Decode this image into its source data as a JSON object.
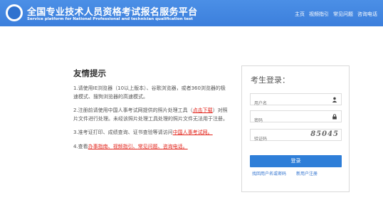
{
  "header": {
    "title_cn": "全国专业技术人员资格考试报名服务平台",
    "title_en": "Service platform for National Professional and technician qualification test",
    "nav": [
      "主页",
      "视频指引",
      "常见问题",
      "咨询电话"
    ]
  },
  "notice": {
    "heading": "友情提示",
    "item1": "1.请使用IE浏览器（10以上版本）、谷歌浏览器，或者360浏览器的极速模式、搜狗浏览器的高速模式。",
    "item2_a": "2.注册前请使用中国人事考试网提供的照片处理工具（",
    "item2_link": "点击下载",
    "item2_b": "）对照片文件进行处理。未经该照片处理工具处理的照片文件无法用于注册。",
    "item3_a": "3.准考证打印、成绩查询、证书查验等请访问",
    "item3_link": "中国人事考试网。",
    "item4_a": "4.查看",
    "item4_links": [
      "办事指南、",
      "视频指引、",
      "常见问题、",
      "咨询电话。"
    ]
  },
  "login": {
    "title": "考生登录：",
    "username_placeholder": "用户名",
    "password_placeholder": "密码",
    "captcha_placeholder": "验证码",
    "captcha_text": "85045",
    "submit": "登录",
    "forgot": "找回用户名或密码",
    "register": "新用户注册"
  }
}
